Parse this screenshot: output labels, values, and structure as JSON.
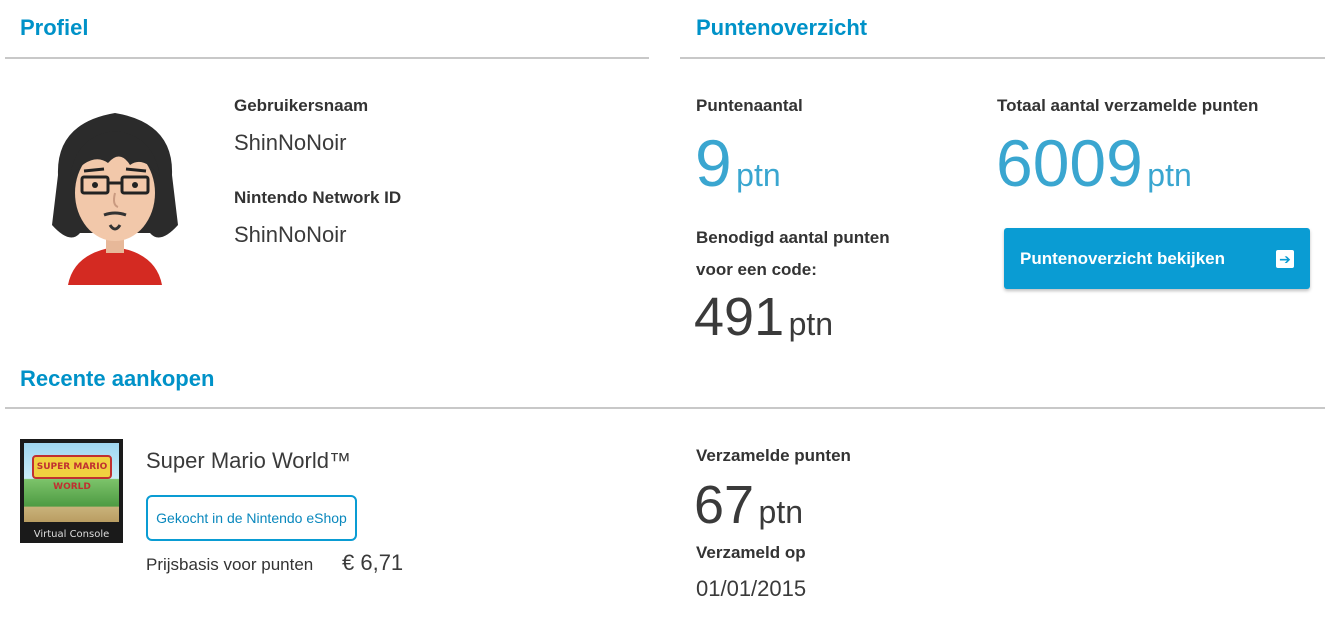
{
  "profile": {
    "title": "Profiel",
    "username_label": "Gebruikersnaam",
    "username": "ShinNoNoir",
    "nnid_label": "Nintendo Network ID",
    "nnid": "ShinNoNoir"
  },
  "points": {
    "title": "Puntenoverzicht",
    "count_label": "Puntenaantal",
    "count": "9",
    "unit": "ptn",
    "total_label": "Totaal aantal verzamelde punten",
    "total": "6009",
    "needed_label_line1": "Benodigd aantal punten",
    "needed_label_line2": "voor een code:",
    "needed": "491",
    "view_button": "Puntenoverzicht bekijken"
  },
  "recent": {
    "title": "Recente aankopen",
    "game_title": "Super Mario World™",
    "box_logo_text": "SUPER MARIO WORLD",
    "box_caption": "Virtual Console",
    "shop_button": "Gekocht in de Nintendo eShop",
    "price_label": "Prijsbasis voor punten",
    "price": "€ 6,71",
    "collected_label": "Verzamelde punten",
    "collected": "67",
    "collected_on_label": "Verzameld op",
    "collected_on": "01/01/2015"
  },
  "colors": {
    "accent": "#0092c8",
    "button": "#0a9cd3",
    "big_number": "#3aa6d0"
  }
}
